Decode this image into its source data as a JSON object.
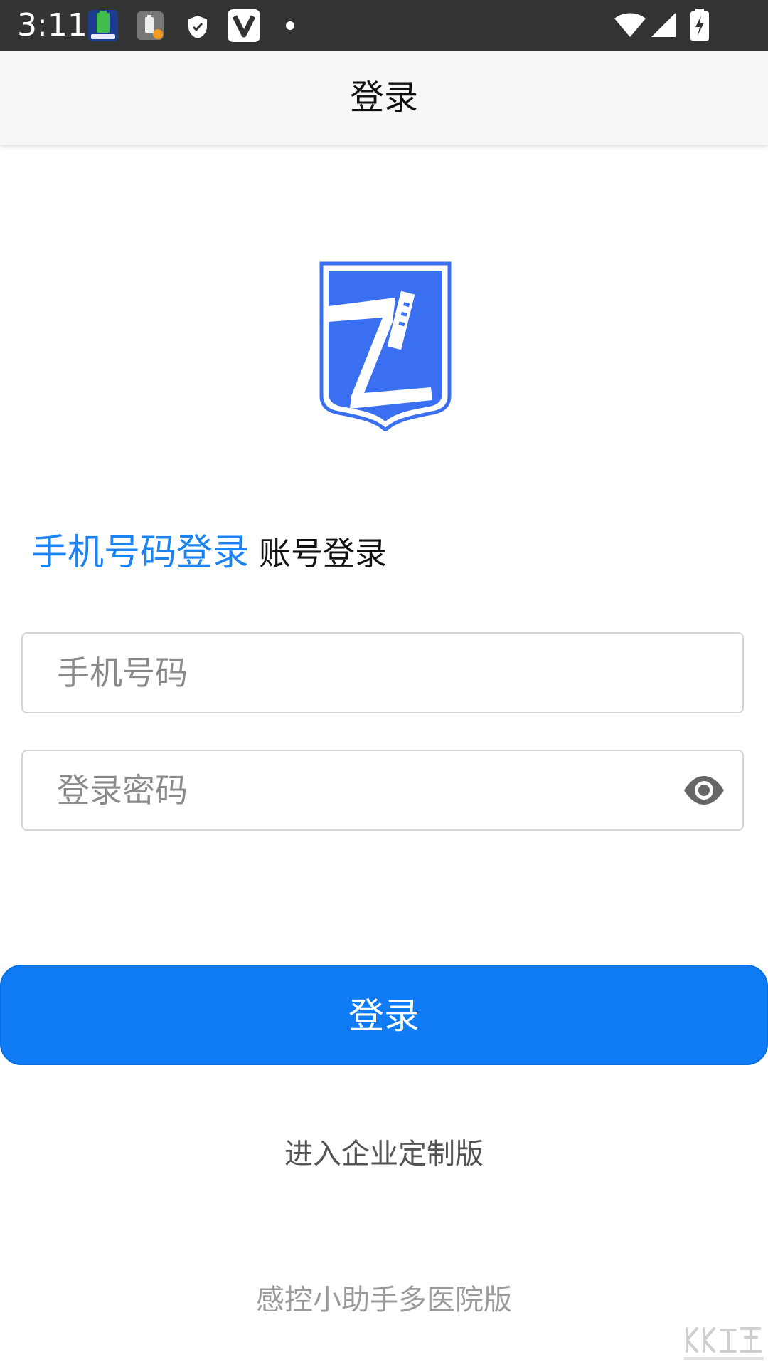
{
  "status_bar": {
    "time": "3:11",
    "icons": [
      "battery-app-icon",
      "battery-alert-icon",
      "shield-icon",
      "v-app-icon",
      "dot-icon",
      "wifi-icon",
      "signal-icon",
      "battery-charging-icon"
    ]
  },
  "app_bar": {
    "title": "登录"
  },
  "logo": {
    "icon": "shield-logo-icon",
    "color": "#3a6ff2"
  },
  "tabs": [
    {
      "label": "手机号码登录",
      "active": true
    },
    {
      "label": "账号登录",
      "active": false
    }
  ],
  "form": {
    "phone": {
      "value": "",
      "placeholder": "手机号码"
    },
    "password": {
      "value": "",
      "placeholder": "登录密码",
      "toggle_icon": "eye-icon"
    }
  },
  "login_button": {
    "label": "登录",
    "color": "#0f7bf5"
  },
  "enterprise_link": {
    "label": "进入企业定制版"
  },
  "footer": {
    "text": "感控小助手多医院版"
  },
  "watermark": {
    "icon": "watermark-logo-icon"
  },
  "colors": {
    "accent": "#1b83f5",
    "status_bar": "#333333",
    "app_bar": "#f7f7f7"
  }
}
